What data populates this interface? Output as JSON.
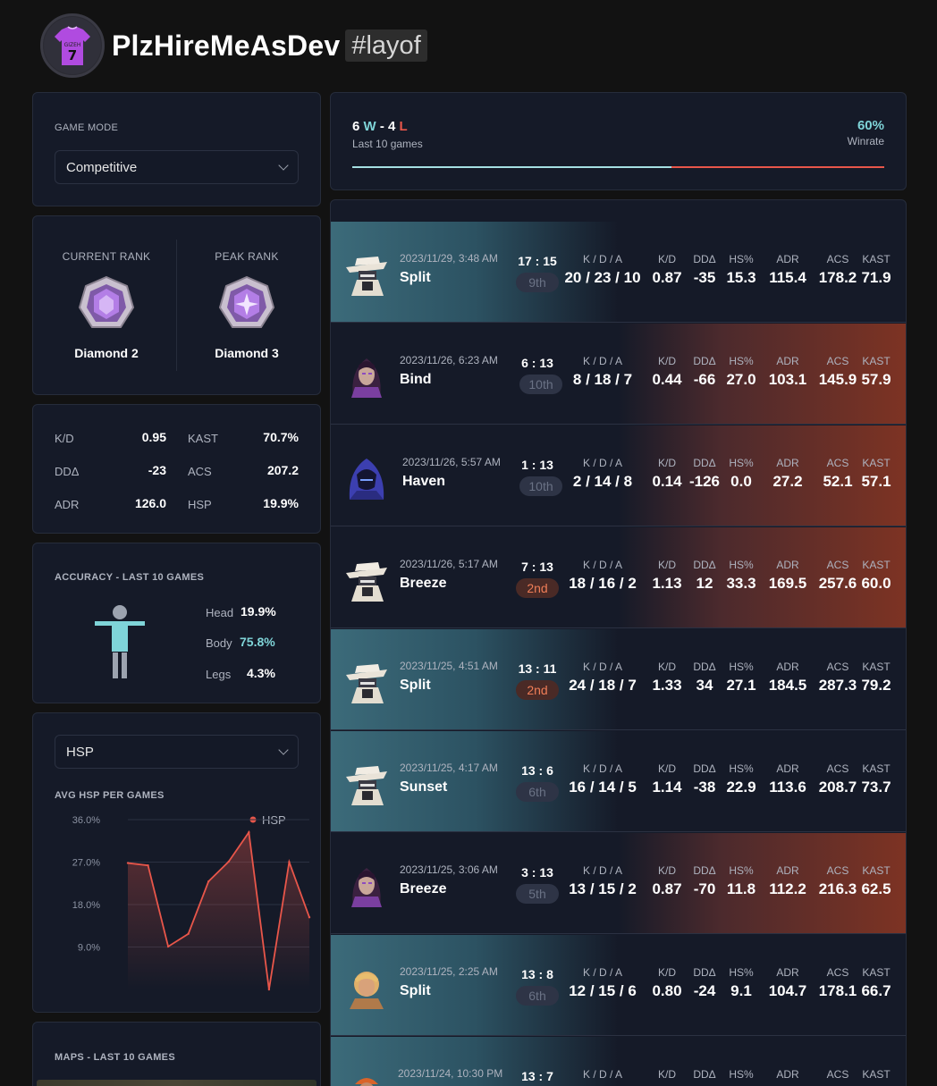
{
  "profile": {
    "username": "PlzHireMeAsDev",
    "tag": "#layof",
    "jersey_text": "GIZEH",
    "jersey_number": "7"
  },
  "mode": {
    "label": "GAME MODE",
    "value": "Competitive"
  },
  "rank": {
    "current_label": "CURRENT RANK",
    "current": "Diamond 2",
    "peak_label": "PEAK RANK",
    "peak": "Diamond 3"
  },
  "stats": [
    {
      "key": "K/D",
      "value": "0.95"
    },
    {
      "key": "KAST",
      "value": "70.7%"
    },
    {
      "key": "DDΔ",
      "value": "-23"
    },
    {
      "key": "ACS",
      "value": "207.2"
    },
    {
      "key": "ADR",
      "value": "126.0"
    },
    {
      "key": "HSP",
      "value": "19.9%"
    }
  ],
  "accuracy": {
    "title": "ACCURACY - LAST 10 GAMES",
    "head_label": "Head",
    "head": "19.9%",
    "body_label": "Body",
    "body": "75.8%",
    "legs_label": "Legs",
    "legs": "4.3%"
  },
  "hsp_panel": {
    "select": "HSP",
    "title": "AVG HSP PER GAMES"
  },
  "maps_panel": {
    "title": "MAPS - LAST 10 GAMES"
  },
  "summary": {
    "wins": "6",
    "w": "W",
    "sep": "-",
    "losses": "4",
    "l": "L",
    "sub": "Last 10 games",
    "winrate": "60%",
    "winrate_label": "Winrate",
    "win_fraction": 0.6
  },
  "headers": {
    "kda": "K / D / A",
    "kd": "K/D",
    "dd": "DDΔ",
    "hs": "HS%",
    "adr": "ADR",
    "acs": "ACS",
    "kast": "KAST"
  },
  "colors": {
    "win": "#7fd4d8",
    "loss": "#e8564a",
    "mvp": "#ef7d57"
  },
  "matches": [
    {
      "result": "win",
      "agent": "cowboy-agent",
      "date": "2023/11/29, 3:48 AM",
      "map": "Split",
      "score": "17 : 15",
      "place": "9th",
      "kda": "20 / 23 / 10",
      "kd": "0.87",
      "dd": "-35",
      "hs": "15.3",
      "adr": "115.4",
      "acs": "178.2",
      "kast": "71.9"
    },
    {
      "result": "loss",
      "agent": "purple-hair-agent",
      "date": "2023/11/26, 6:23 AM",
      "map": "Bind",
      "score": "6 : 13",
      "place": "10th",
      "kda": "8 / 18 / 7",
      "kd": "0.44",
      "dd": "-66",
      "hs": "27.0",
      "adr": "103.1",
      "acs": "145.9",
      "kast": "57.9"
    },
    {
      "result": "loss",
      "agent": "hooded-agent",
      "date": "2023/11/26, 5:57 AM",
      "map": "Haven",
      "score": "1 : 13",
      "place": "10th",
      "kda": "2 / 14 / 8",
      "kd": "0.14",
      "dd": "-126",
      "hs": "0.0",
      "adr": "27.2",
      "acs": "52.1",
      "kast": "57.1"
    },
    {
      "result": "loss",
      "agent": "cowboy-agent",
      "date": "2023/11/26, 5:17 AM",
      "map": "Breeze",
      "score": "7 : 13",
      "place": "2nd",
      "kda": "18 / 16 / 2",
      "kd": "1.13",
      "dd": "12",
      "hs": "33.3",
      "adr": "169.5",
      "acs": "257.6",
      "kast": "60.0"
    },
    {
      "result": "win",
      "agent": "cowboy-agent",
      "date": "2023/11/25, 4:51 AM",
      "map": "Split",
      "score": "13 : 11",
      "place": "2nd",
      "kda": "24 / 18 / 7",
      "kd": "1.33",
      "dd": "34",
      "hs": "27.1",
      "adr": "184.5",
      "acs": "287.3",
      "kast": "79.2"
    },
    {
      "result": "win",
      "agent": "cowboy-agent",
      "date": "2023/11/25, 4:17 AM",
      "map": "Sunset",
      "score": "13 : 6",
      "place": "6th",
      "kda": "16 / 14 / 5",
      "kd": "1.14",
      "dd": "-38",
      "hs": "22.9",
      "adr": "113.6",
      "acs": "208.7",
      "kast": "73.7"
    },
    {
      "result": "loss",
      "agent": "purple-hair-agent",
      "date": "2023/11/25, 3:06 AM",
      "map": "Breeze",
      "score": "3 : 13",
      "place": "5th",
      "kda": "13 / 15 / 2",
      "kd": "0.87",
      "dd": "-70",
      "hs": "11.8",
      "adr": "112.2",
      "acs": "216.3",
      "kast": "62.5"
    },
    {
      "result": "win",
      "agent": "blonde-agent",
      "date": "2023/11/25, 2:25 AM",
      "map": "Split",
      "score": "13 : 8",
      "place": "6th",
      "kda": "12 / 15 / 6",
      "kd": "0.80",
      "dd": "-24",
      "hs": "9.1",
      "adr": "104.7",
      "acs": "178.1",
      "kast": "66.7"
    },
    {
      "result": "win",
      "agent": "orange-cap-agent",
      "date": "2023/11/24, 10:30 PM",
      "map": "",
      "score": "13 : 7",
      "place": "",
      "kda": "",
      "kd": "",
      "dd": "",
      "hs": "",
      "adr": "",
      "acs": "",
      "kast": ""
    }
  ],
  "chart_data": {
    "type": "line",
    "title": "AVG HSP PER GAMES",
    "series": [
      {
        "name": "HSP",
        "values": [
          26.8,
          26.3,
          9.1,
          11.8,
          22.9,
          27.1,
          33.3,
          0.0,
          27.0,
          15.3
        ]
      }
    ],
    "y_ticks": [
      "9.0%",
      "18.0%",
      "27.0%",
      "36.0%"
    ],
    "ylim": [
      0,
      36
    ],
    "grid": true,
    "legend": "top-right",
    "color": "#e8564a"
  }
}
